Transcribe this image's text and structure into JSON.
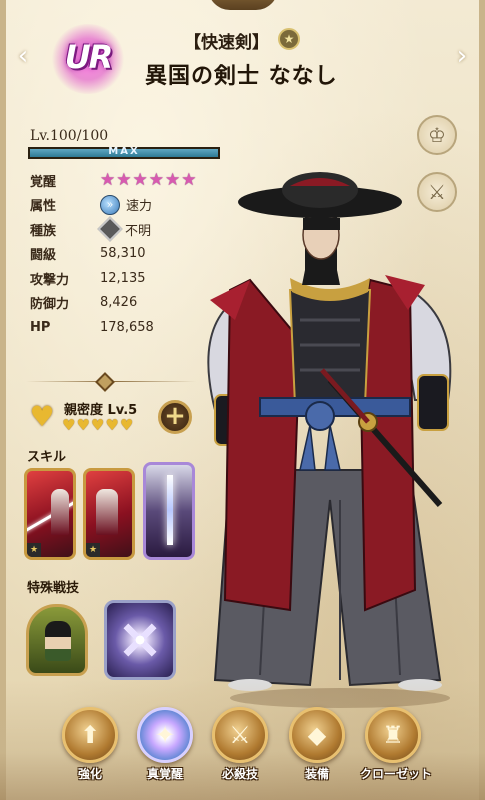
{
  "header": {
    "rarity": "UR",
    "char_type": "【快速剣】",
    "type_icon": "★",
    "name": "異国の剣士 ななし",
    "nav_left": "‹",
    "nav_right": "›"
  },
  "level": {
    "label": "Lv.100/100",
    "max_text": "MAX",
    "progress": 1.0
  },
  "stats": {
    "awakening_label": "覚醒",
    "awakening_stars": 6,
    "attribute_label": "属性",
    "attribute_value": "速力",
    "race_label": "種族",
    "race_value": "不明",
    "combat_label": "闘級",
    "combat_value": "58,310",
    "attack_label": "攻撃力",
    "attack_value": "12,135",
    "defense_label": "防御力",
    "defense_value": "8,426",
    "hp_label": "HP",
    "hp_value": "178,658"
  },
  "affinity": {
    "label": "親密度 Lv.5",
    "hearts": 5,
    "plus": "+"
  },
  "skills": {
    "title": "スキル",
    "cards": [
      "skill-1",
      "skill-2",
      "ultimate"
    ]
  },
  "special": {
    "title": "特殊戦技"
  },
  "menu": [
    {
      "label": "強化",
      "icon": "⬆"
    },
    {
      "label": "真覚醒",
      "icon": "✦"
    },
    {
      "label": "必殺技",
      "icon": "⚔"
    },
    {
      "label": "装備",
      "icon": "◆"
    },
    {
      "label": "クローゼット",
      "icon": "♜"
    }
  ],
  "side_icons": {
    "icon1": "♔",
    "icon2": "⚔"
  },
  "colors": {
    "background": "#efe4c8",
    "star": "#d85ab0",
    "level_bar": "#2e7a94",
    "heart": "#e8b830",
    "robe": "#8a1a24"
  }
}
